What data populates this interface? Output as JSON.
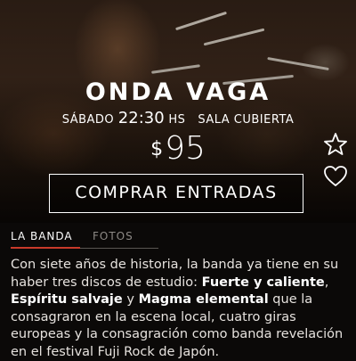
{
  "event": {
    "title": "ONDA VAGA",
    "day": "SÁBADO",
    "time": "22:30",
    "time_suffix": "HS",
    "venue": "SALA CUBIERTA",
    "currency": "$",
    "price": "95"
  },
  "actions": {
    "buy_label": "COMPRAR ENTRADAS",
    "favorite_icon": "star-icon",
    "like_icon": "heart-icon"
  },
  "tabs": [
    {
      "label": "LA BANDA",
      "active": true
    },
    {
      "label": "FOTOS",
      "active": false
    }
  ],
  "description": {
    "p1": "Con siete años de historia, la banda ya tiene en su haber tres discos de estudio: ",
    "album1": "Fuerte y caliente",
    "sep1": ", ",
    "album2": "Espíritu salvaje",
    "sep2": " y ",
    "album3": "Magma elemental",
    "p2": " que la consagraron en la escena local, cuatro giras europeas y la consagración como banda revelación en el festival Fuji Rock de Japón."
  },
  "colors": {
    "accent": "#c83a2a",
    "background": "#0b0908",
    "inactive_tab": "#8d8985"
  }
}
